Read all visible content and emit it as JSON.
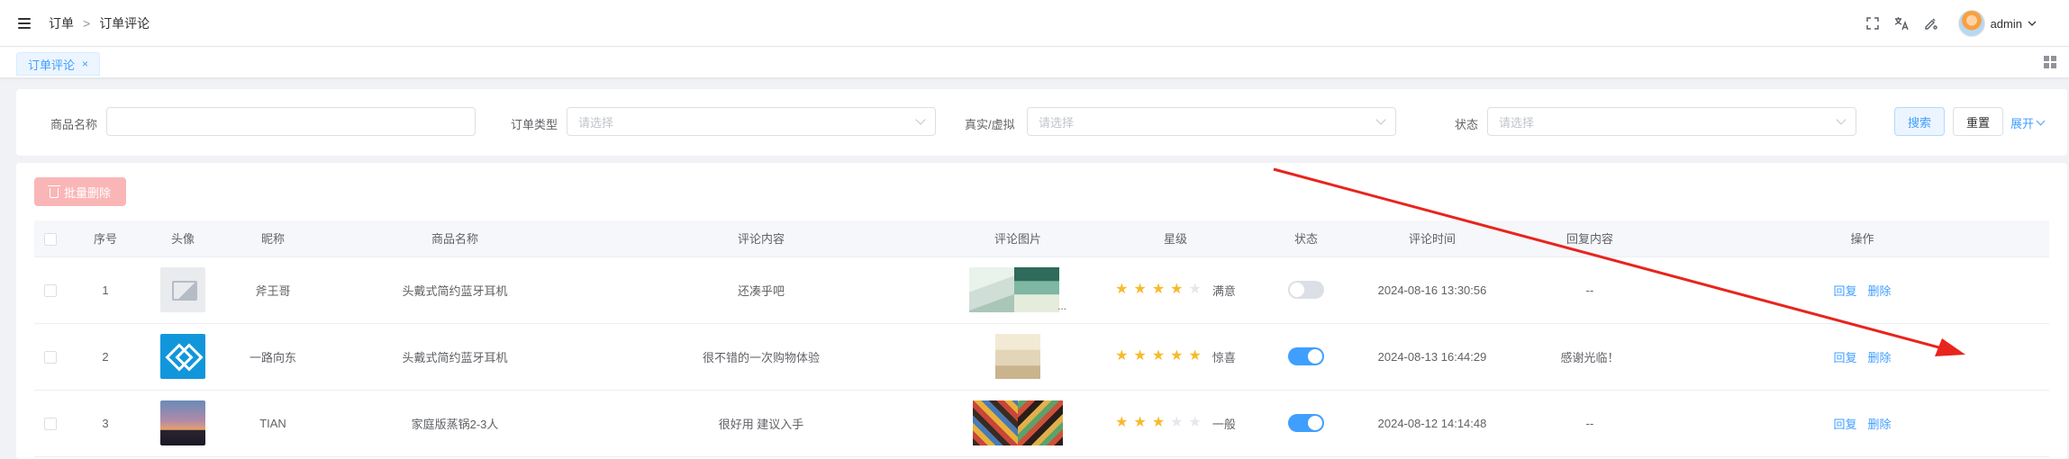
{
  "header": {
    "breadcrumb": [
      "订单",
      "订单评论"
    ],
    "breadcrumb_sep": ">",
    "icons": [
      "fullscreen-icon",
      "translate-icon",
      "theme-icon"
    ],
    "user": "admin"
  },
  "tags": {
    "active": "订单评论",
    "close": "×"
  },
  "search": {
    "fields": [
      {
        "label": "商品名称",
        "placeholder": ""
      },
      {
        "label": "订单类型",
        "placeholder": "请选择"
      },
      {
        "label": "真实/虚拟",
        "placeholder": "请选择"
      },
      {
        "label": "状态",
        "placeholder": "请选择"
      }
    ],
    "search_btn": "搜索",
    "reset_btn": "重置",
    "expand": "展开"
  },
  "toolbar": {
    "batch_delete": "批量删除"
  },
  "table": {
    "headers": [
      "序号",
      "头像",
      "昵称",
      "商品名称",
      "评论内容",
      "评论图片",
      "星级",
      "状态",
      "评论时间",
      "回复内容",
      "操作"
    ],
    "rows": [
      {
        "index": "1",
        "nickname": "斧王哥",
        "product": "头戴式简约蓝牙耳机",
        "content": "还凑乎吧",
        "rating": 4,
        "rating_text": "满意",
        "status_on": false,
        "time": "2024-08-16 13:30:56",
        "reply": "--",
        "images_more": "..."
      },
      {
        "index": "2",
        "nickname": "一路向东",
        "product": "头戴式简约蓝牙耳机",
        "content": "很不错的一次购物体验",
        "rating": 5,
        "rating_text": "惊喜",
        "status_on": true,
        "time": "2024-08-13 16:44:29",
        "reply": "感谢光临！",
        "images_more": ""
      },
      {
        "index": "3",
        "nickname": "TIAN",
        "product": "家庭版蒸锅2-3人",
        "content": "很好用 建议入手",
        "rating": 3,
        "rating_text": "一般",
        "status_on": true,
        "time": "2024-08-12 14:14:48",
        "reply": "--",
        "images_more": ""
      }
    ],
    "op_reply": "回复",
    "op_delete": "删除"
  },
  "colors": {
    "primary": "#409eff",
    "danger_light": "#fab6b6",
    "star": "#f7ba2a",
    "annotation": "#e8241c"
  }
}
